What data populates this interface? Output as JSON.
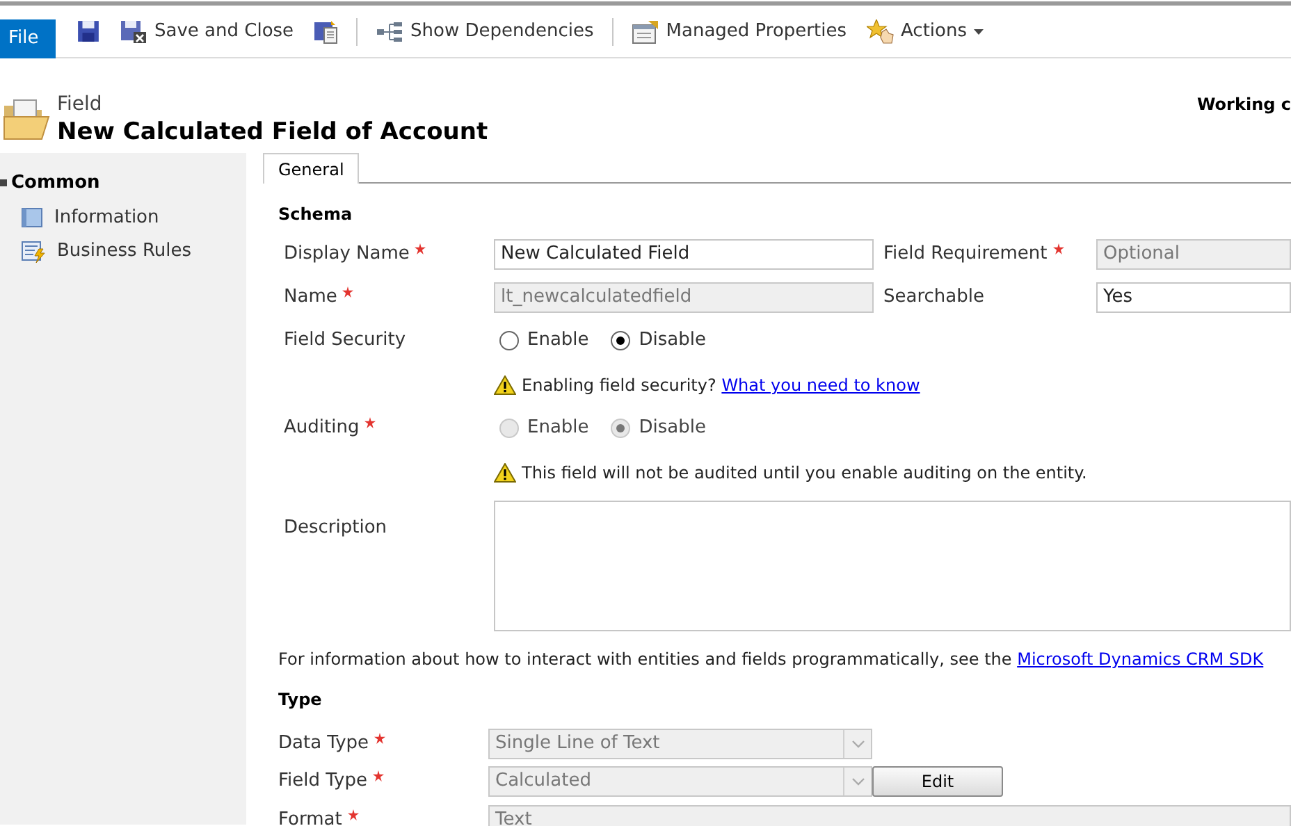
{
  "toolbar": {
    "file_tab": "File",
    "items": [
      {
        "kind": "save"
      },
      {
        "kind": "save_close",
        "label": "Save and Close"
      },
      {
        "kind": "publish"
      },
      {
        "kind": "dependencies",
        "label": "Show Dependencies"
      },
      {
        "kind": "properties",
        "label": "Managed Properties"
      },
      {
        "kind": "actions",
        "label": "Actions"
      }
    ]
  },
  "header": {
    "entity": "Field",
    "title": "New Calculated Field of Account",
    "status": "Working c"
  },
  "sidebar": {
    "group": "Common",
    "items": [
      {
        "kind": "info",
        "label": "Information"
      },
      {
        "kind": "rules",
        "label": "Business Rules"
      }
    ]
  },
  "tabs": [
    {
      "label": "General",
      "selected": true
    }
  ],
  "schema": {
    "title": "Schema",
    "display_name": {
      "label": "Display Name",
      "required": true,
      "value": "New Calculated Field",
      "disabled": false
    },
    "field_requirement": {
      "label": "Field Requirement",
      "required": true,
      "value": "Optional",
      "disabled": true
    },
    "name": {
      "label": "Name",
      "required": true,
      "value": "lt_newcalculatedfield",
      "disabled": true
    },
    "searchable": {
      "label": "Searchable",
      "value": "Yes",
      "disabled": false
    },
    "field_security": {
      "label": "Field Security",
      "disabled": false,
      "options": [
        {
          "label": "Enable",
          "selected": false
        },
        {
          "label": "Disable",
          "selected": true
        }
      ]
    },
    "security_note": {
      "text": "Enabling field security?",
      "link": "What you need to know"
    },
    "auditing": {
      "label": "Auditing",
      "required": true,
      "disabled": true,
      "options": [
        {
          "label": "Enable",
          "selected": false
        },
        {
          "label": "Disable",
          "selected": true
        }
      ]
    },
    "auditing_note": {
      "text": "This field will not be audited until you enable auditing on the entity."
    },
    "description": {
      "label": "Description"
    }
  },
  "info": {
    "text": "For information about how to interact with entities and fields programmatically, see the",
    "link": "Microsoft Dynamics CRM SDK"
  },
  "type": {
    "title": "Type",
    "data_type": {
      "label": "Data Type",
      "required": true,
      "value": "Single Line of Text",
      "disabled": true
    },
    "field_type": {
      "label": "Field Type",
      "required": true,
      "value": "Calculated",
      "disabled": true,
      "button": "Edit"
    },
    "format": {
      "label": "Format",
      "required": true,
      "value": "Text",
      "disabled": true
    }
  }
}
